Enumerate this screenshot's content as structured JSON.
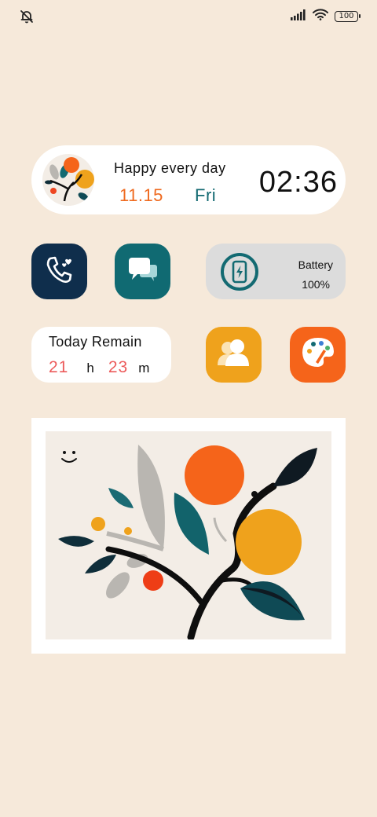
{
  "status_bar": {
    "left_icon": "muted-bell-icon",
    "signal_icon": "signal-bars-icon",
    "wifi_icon": "wifi-icon",
    "battery_level": "100"
  },
  "top_widget": {
    "greeting": "Happy every day",
    "date": "11.15",
    "weekday": "Fri",
    "time": "02:36",
    "avatar_icon": "tree-art-icon"
  },
  "apps": {
    "phone": {
      "icon": "phone-icon"
    },
    "messages": {
      "icon": "chat-bubbles-icon"
    },
    "contacts": {
      "icon": "people-icon"
    },
    "themes": {
      "icon": "palette-icon"
    }
  },
  "battery_widget": {
    "label": "Battery",
    "value": "100%",
    "icon": "charging-phone-icon"
  },
  "remain_widget": {
    "title": "Today Remain",
    "hours": "21",
    "hours_unit": "h",
    "minutes": "23",
    "minutes_unit": "m"
  },
  "picture_widget": {
    "art": "tree-illustration",
    "face_icon": "smiley-icon"
  },
  "colors": {
    "background": "#f6e9da",
    "orange": "#ef6a1f",
    "teal": "#136a72",
    "navy": "#0f2e4c",
    "yellow": "#efa21c",
    "coral": "#ec5b5b"
  }
}
